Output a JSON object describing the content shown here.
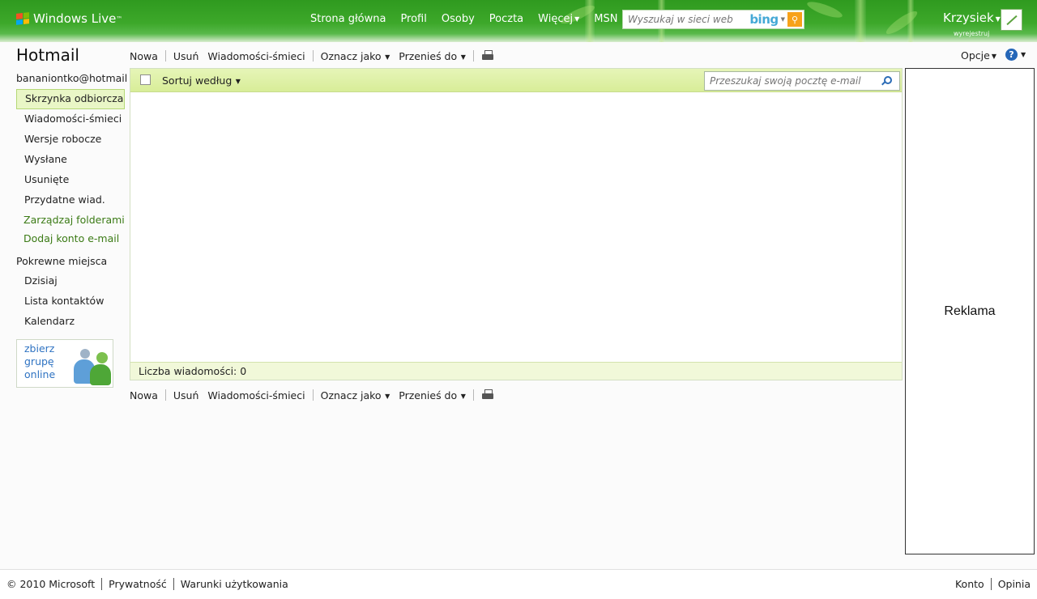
{
  "header": {
    "brand": "Windows Live",
    "brand_mark": "™",
    "nav": [
      "Strona główna",
      "Profil",
      "Osoby",
      "Poczta",
      "Więcej",
      "MSN"
    ],
    "web_search_placeholder": "Wyszukaj w sieci web",
    "search_engine": "bing",
    "user_name": "Krzysiek",
    "sign_out": "wyrejestruj"
  },
  "sidebar": {
    "app_title": "Hotmail",
    "account": "bananiontko@hotmail.com",
    "folders": [
      "Skrzynka odbiorcza",
      "Wiadomości-śmieci",
      "Wersje robocze",
      "Wysłane",
      "Usunięte",
      "Przydatne wiad."
    ],
    "links": [
      "Zarządzaj folderami",
      "Dodaj konto e-mail"
    ],
    "related_title": "Pokrewne miejsca",
    "related": [
      "Dzisiaj",
      "Lista kontaktów",
      "Kalendarz"
    ],
    "promo": "zbierz grupę online"
  },
  "toolbar": {
    "new": "Nowa",
    "delete": "Usuń",
    "junk": "Wiadomości-śmieci",
    "mark_as": "Oznacz jako",
    "move_to": "Przenieś do",
    "options": "Opcje"
  },
  "list": {
    "sort_by": "Sortuj według",
    "search_placeholder": "Przeszukaj swoją pocztę e-mail",
    "count_label": "Liczba wiadomości: 0"
  },
  "ad": {
    "label": "Reklama"
  },
  "footer": {
    "copyright": "© 2010 Microsoft",
    "privacy": "Prywatność",
    "terms": "Warunki użytkowania",
    "account": "Konto",
    "feedback": "Opinia"
  },
  "colors": {
    "header_green": "#3da82a",
    "link_green": "#3a7a14",
    "list_header": "#d8ed98",
    "bing_blue": "#45a9d6"
  }
}
